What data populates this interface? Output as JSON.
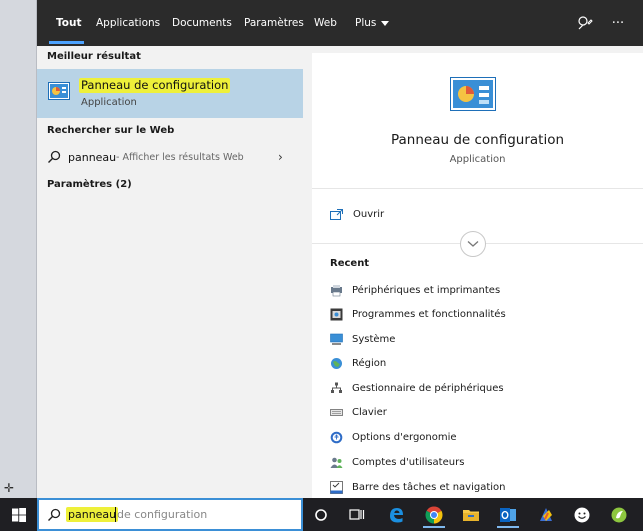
{
  "tabs": [
    {
      "label": "Tout",
      "active": true
    },
    {
      "label": "Applications"
    },
    {
      "label": "Documents"
    },
    {
      "label": "Paramètres"
    },
    {
      "label": "Web"
    },
    {
      "label": "Plus"
    }
  ],
  "topbar_icons": [
    "feedback-icon",
    "more-options-icon"
  ],
  "left": {
    "best_match_header": "Meilleur résultat",
    "best_match": {
      "title": "Panneau de configuration",
      "subtitle": "Application"
    },
    "web_header": "Rechercher sur le Web",
    "web_result": {
      "query": "panneau",
      "hint": "- Afficher les résultats Web"
    },
    "settings_header": "Paramètres (2)"
  },
  "detail": {
    "title": "Panneau de configuration",
    "subtitle": "Application",
    "open_label": "Ouvrir",
    "recent_header": "Recent",
    "recent": [
      {
        "label": "Périphériques et imprimantes",
        "icon": "devices-printers-icon"
      },
      {
        "label": "Programmes et fonctionnalités",
        "icon": "programs-features-icon"
      },
      {
        "label": "Système",
        "icon": "system-icon"
      },
      {
        "label": "Région",
        "icon": "region-icon"
      },
      {
        "label": "Gestionnaire de périphériques",
        "icon": "device-manager-icon"
      },
      {
        "label": "Clavier",
        "icon": "keyboard-icon"
      },
      {
        "label": "Options d'ergonomie",
        "icon": "ease-of-access-icon"
      },
      {
        "label": "Comptes d'utilisateurs",
        "icon": "user-accounts-icon"
      },
      {
        "label": "Barre des tâches et navigation",
        "icon": "taskbar-navigation-icon"
      }
    ]
  },
  "taskbar": {
    "search_typed": "panneau",
    "search_suggestion": "de configuration",
    "apps": [
      "cortana-icon",
      "task-view-icon",
      "edge-icon",
      "chrome-icon",
      "file-explorer-icon",
      "outlook-icon",
      "app-icon",
      "smiley-icon",
      "green-app-icon"
    ]
  },
  "colors": {
    "topbar": "#2b2b2b",
    "accent": "#4da3ff",
    "selection": "#b8d3e6",
    "highlight": "#eef03a",
    "taskbar": "#1f1f23"
  }
}
